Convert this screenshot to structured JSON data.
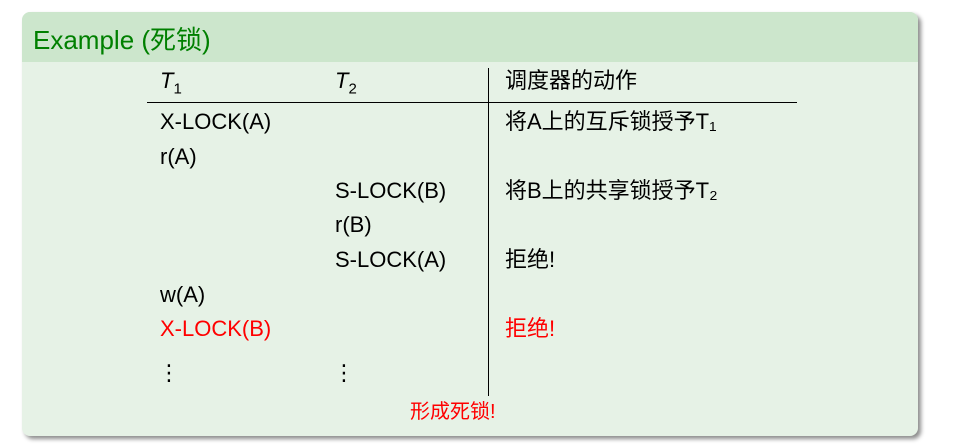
{
  "title": "Example (死锁)",
  "headers": {
    "t1": "T",
    "t1_sub": "1",
    "t2": "T",
    "t2_sub": "2",
    "action": "调度器的动作"
  },
  "rows": [
    {
      "t1": "X-LOCK(A)",
      "action": "将A上的互斥锁授予T₁"
    },
    {
      "t1": "r(A)"
    },
    {
      "t2": "S-LOCK(B)",
      "action": "将B上的共享锁授予T₂"
    },
    {
      "t2": "r(B)"
    },
    {
      "t2": "S-LOCK(A)",
      "action": "拒绝!"
    },
    {
      "t1": "w(A)"
    },
    {
      "t1": "X-LOCK(B)",
      "action": "拒绝!",
      "highlight": "#ff0000"
    },
    {
      "t1": "⋮",
      "t2": "⋮"
    }
  ],
  "conclusion": "形成死锁!",
  "colors": {
    "title": "#008000",
    "header_bg": "#cce6cc",
    "body_bg": "#e6f2e6",
    "alert": "#ff0000"
  }
}
